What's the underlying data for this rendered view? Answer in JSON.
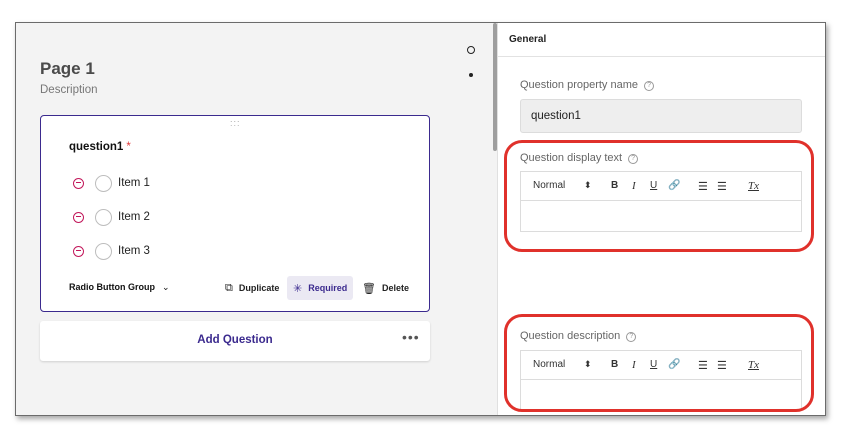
{
  "designer": {
    "page_title": "Page 1",
    "page_description": "Description",
    "question": {
      "drag_handle": ":::",
      "title": "question1",
      "required_marker": "*",
      "items": [
        {
          "label": "Item 1"
        },
        {
          "label": "Item 2"
        },
        {
          "label": "Item 3"
        }
      ],
      "type_label": "Radio Button Group",
      "type_chevron": "⌄",
      "duplicate_label": "Duplicate",
      "required_label": "Required",
      "delete_label": "Delete"
    },
    "add_question_label": "Add Question",
    "more_icon": "•••"
  },
  "properties": {
    "section_title": "General",
    "property_name_label": "Question property name",
    "property_name_value": "question1",
    "display_text_label": "Question display text",
    "description_label": "Question description",
    "toolbar": {
      "format": "Normal",
      "format_arrow": "⬍",
      "bold": "B",
      "italic": "I",
      "underline": "U",
      "link": "🔗",
      "ordered_list": "☰",
      "bullet_list": "☰",
      "clear": "Tx"
    },
    "help_glyph": "?"
  },
  "colors": {
    "accent": "#3b2a8e",
    "required": "#e0383a",
    "remove": "#c2185b",
    "annotation": "#e0312b"
  }
}
